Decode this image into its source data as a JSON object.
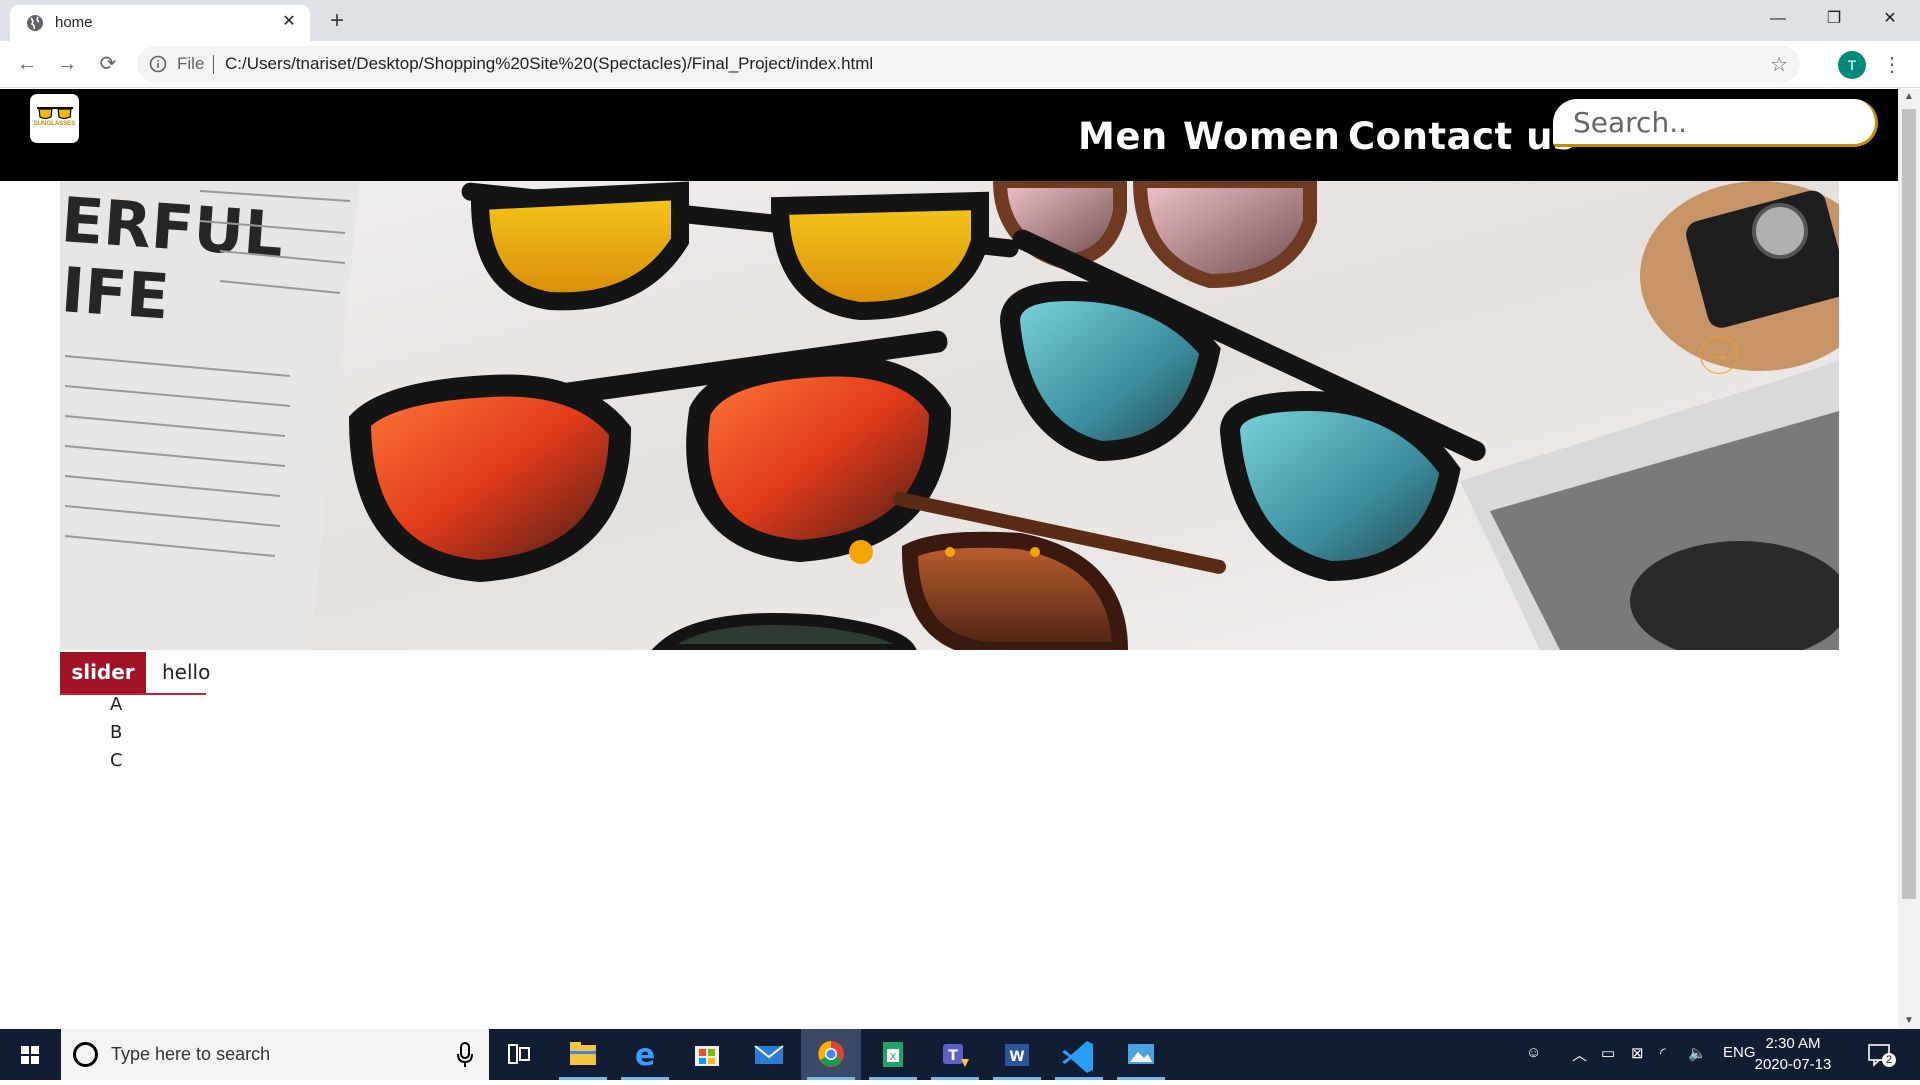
{
  "browser": {
    "tab_title": "home",
    "tab_close": "✕",
    "new_tab": "+",
    "address_scheme": "File",
    "address_url": "C:/Users/tnariset/Desktop/Shopping%20Site%20(Spectacles)/Final_Project/index.html",
    "profile_initial": "T",
    "window_controls": {
      "minimize": "—",
      "restore": "❐",
      "close": "✕"
    }
  },
  "site": {
    "logo_text": "SUNGLASSES",
    "nav": [
      "Men",
      "Women",
      "Contact us"
    ],
    "search_placeholder": "Search..",
    "slider": {
      "prev_arrow": "←",
      "next_arrow": "→",
      "dots": 3,
      "active_dot": 0
    },
    "tabs": {
      "active": "slider",
      "inactive": "hello"
    },
    "list": [
      "A",
      "B",
      "C"
    ]
  },
  "taskbar": {
    "search_placeholder": "Type here to search",
    "language": "ENG",
    "time": "2:30 AM",
    "date": "2020-07-13",
    "notification_count": "2",
    "apps": [
      "task-view-icon",
      "file-explorer-icon",
      "edge-icon",
      "store-icon",
      "mail-icon",
      "chrome-icon",
      "excel-icon",
      "teams-icon",
      "word-icon",
      "vscode-icon",
      "photos-icon"
    ],
    "active_app": "chrome-icon"
  }
}
